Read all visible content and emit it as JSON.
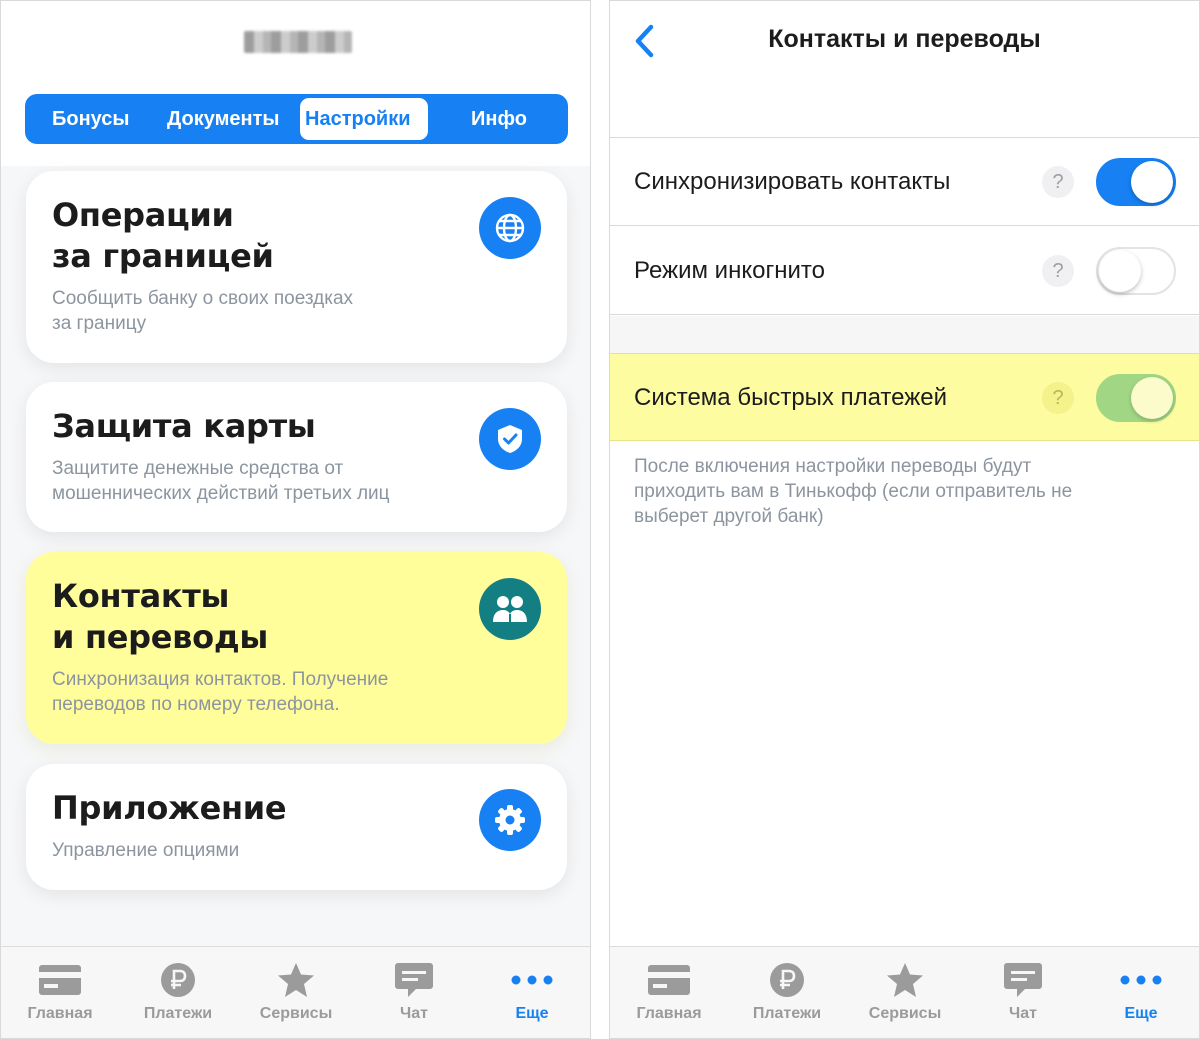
{
  "left": {
    "segmented": [
      "Бонусы",
      "Документы",
      "Настройки",
      "Инфо"
    ],
    "active_segment": "Настройки",
    "cards": [
      {
        "title": "Операции\nза границей",
        "description": "Сообщить банку о своих поездках\nза границу",
        "icon": "globe-icon"
      },
      {
        "title": "Защита карты",
        "description": "Защитите денежные средства от\nмошеннических действий третьих лиц",
        "icon": "shield-check-icon"
      },
      {
        "title": "Контакты\nи переводы",
        "description": "Синхронизация контактов. Получение\nпереводов по номеру телефона.",
        "icon": "people-icon"
      },
      {
        "title": "Приложение",
        "description": "Управление опциями",
        "icon": "gear-icon"
      }
    ],
    "highlight_color": "#fffe9b"
  },
  "right": {
    "title": "Контакты и переводы",
    "settings": [
      {
        "label": "Синхронизировать контакты",
        "enabled": true
      },
      {
        "label": "Режим инкогнито",
        "enabled": false
      },
      {
        "label": "Система быстрых платежей",
        "enabled": true
      }
    ],
    "help_symbol": "?",
    "footnote": "После включения настройки переводы будут\nприходить вам в Тинькофф (если отправитель не\nвыберет другой банк)"
  },
  "tabbar": {
    "items": [
      {
        "label": "Главная",
        "icon": "card-icon"
      },
      {
        "label": "Платежи",
        "icon": "ruble-icon"
      },
      {
        "label": "Сервисы",
        "icon": "star-icon"
      },
      {
        "label": "Чат",
        "icon": "chat-icon"
      },
      {
        "label": "Еще",
        "icon": "more-icon"
      }
    ],
    "active": "Еще"
  },
  "colors": {
    "accent": "#1781f4",
    "highlight": "#fdfca0",
    "teal": "#137f83",
    "muted": "#9b9b9b"
  }
}
